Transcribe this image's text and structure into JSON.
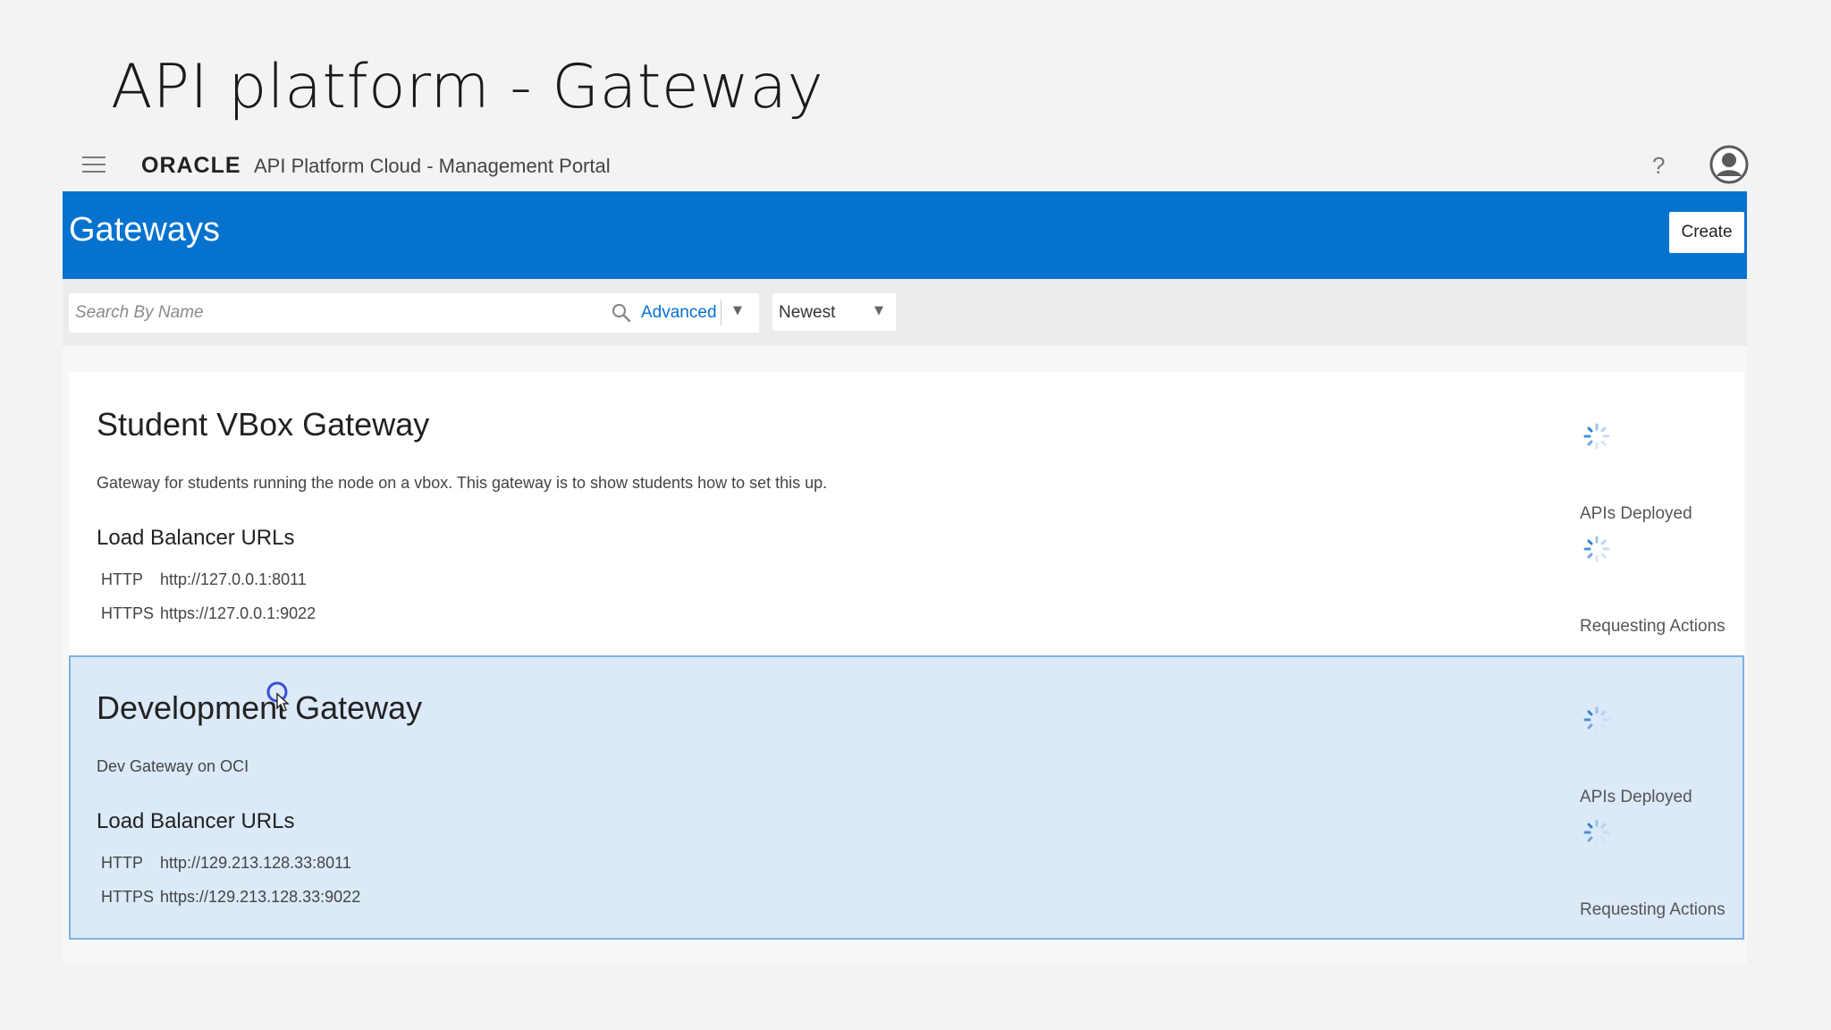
{
  "slide": {
    "title": "API platform - Gateway"
  },
  "topbar": {
    "menu_icon": "hamburger-menu-icon",
    "brand": "ORACLE",
    "portal_name": "API Platform Cloud - Management Portal",
    "help_icon": "help-icon",
    "help_glyph": "?",
    "user_icon": "user-avatar-icon"
  },
  "header": {
    "title": "Gateways",
    "create_label": "Create",
    "background_color": "#0572ce"
  },
  "filters": {
    "search_placeholder": "Search By Name",
    "search_value": "",
    "search_icon": "search-icon",
    "advanced_label": "Advanced",
    "advanced_caret": "▼",
    "sort_value": "Newest",
    "sort_caret": "▼"
  },
  "gateways": [
    {
      "name": "Student VBox Gateway",
      "description": "Gateway for students running the node on a vbox. This gateway is to show students how to set this up.",
      "lb_title": "Load Balancer URLs",
      "urls": [
        {
          "protocol": "HTTP",
          "url": "http://127.0.0.1:8011"
        },
        {
          "protocol": "HTTPS",
          "url": "https://127.0.0.1:9022"
        }
      ],
      "stats": [
        {
          "label": "APIs Deployed",
          "icon": "loading-spinner-icon"
        },
        {
          "label": "Requesting Actions",
          "icon": "loading-spinner-icon"
        }
      ],
      "selected": false
    },
    {
      "name": "Development Gateway",
      "description": "Dev Gateway on OCI",
      "lb_title": "Load Balancer URLs",
      "urls": [
        {
          "protocol": "HTTP",
          "url": "http://129.213.128.33:8011"
        },
        {
          "protocol": "HTTPS",
          "url": "https://129.213.128.33:9022"
        }
      ],
      "stats": [
        {
          "label": "APIs Deployed",
          "icon": "loading-spinner-icon"
        },
        {
          "label": "Requesting Actions",
          "icon": "loading-spinner-icon"
        }
      ],
      "selected": true
    }
  ],
  "colors": {
    "accent": "#0572ce",
    "selected_card": "#dbe9f8",
    "selected_border": "#7fb1e3"
  }
}
